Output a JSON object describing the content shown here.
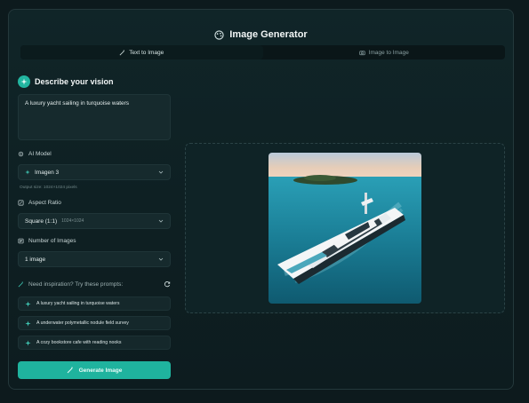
{
  "header": {
    "title": "Image Generator",
    "logo_icon": "palette-icon"
  },
  "tabs": [
    {
      "label": "Text to Image",
      "icon": "wand-icon",
      "active": true
    },
    {
      "label": "Image to Image",
      "icon": "camera-icon",
      "active": false
    }
  ],
  "vision": {
    "title": "Describe your vision",
    "prompt_value": "A luxury yacht sailing in turquoise waters"
  },
  "model": {
    "label": "AI Model",
    "selected": "Imagen 3",
    "hint": "Output size: 1024×1024 pixels"
  },
  "aspect": {
    "label": "Aspect Ratio",
    "selected": "Square (1:1)",
    "selected_detail": "1024×1024"
  },
  "count": {
    "label": "Number of Images",
    "selected": "1 image"
  },
  "inspiration": {
    "label": "Need inspiration? Try these prompts:",
    "prompts": [
      "A luxury yacht sailing in turquoise waters",
      "A underwater polymetallic nodule field survey",
      "A cozy bookstore cafe with reading nooks"
    ]
  },
  "generate_label": "Generate Image",
  "colors": {
    "accent": "#1fb39e",
    "background": "#0d1a1d",
    "panel": "#162a2d"
  }
}
